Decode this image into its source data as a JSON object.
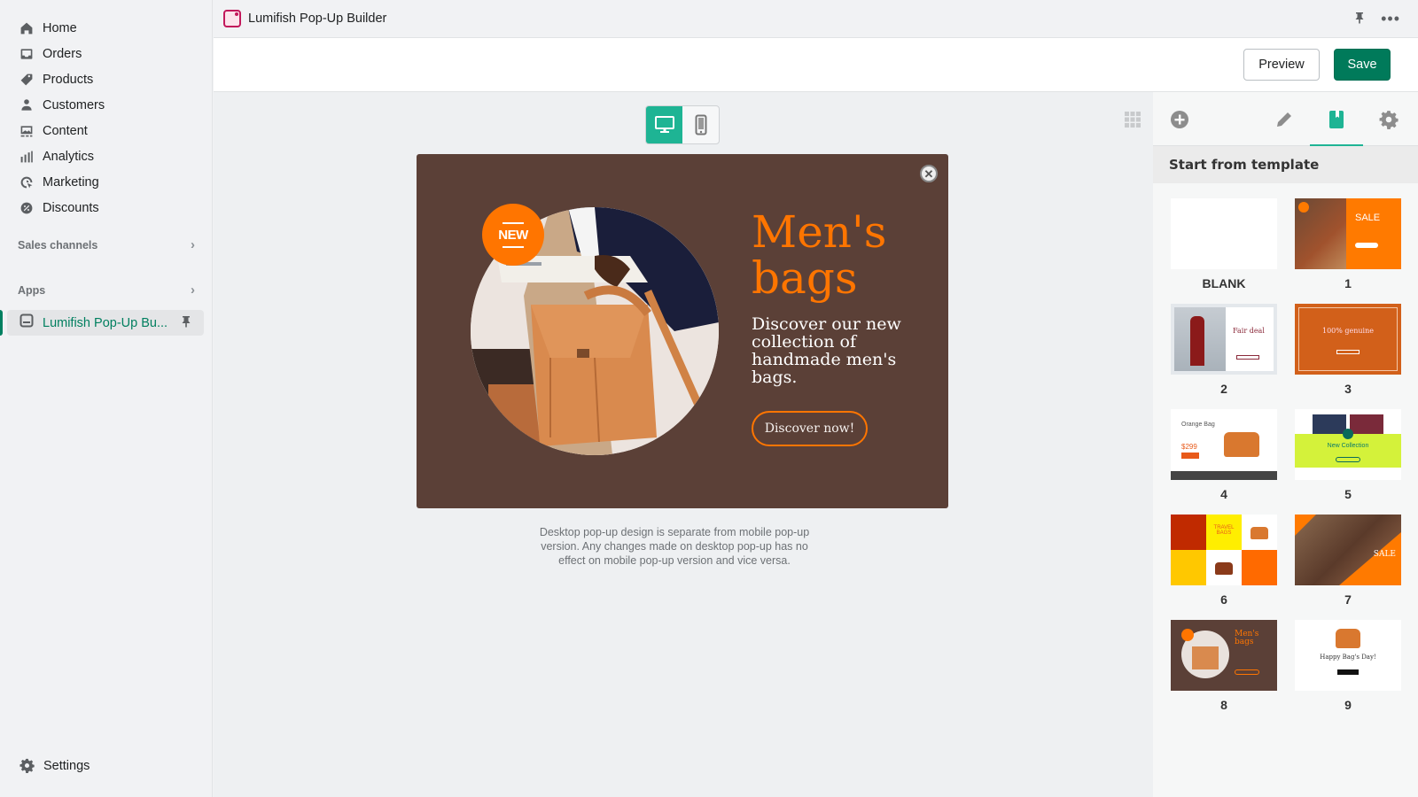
{
  "sidebar": {
    "nav": [
      {
        "label": "Home",
        "icon": "home-icon"
      },
      {
        "label": "Orders",
        "icon": "inbox-icon"
      },
      {
        "label": "Products",
        "icon": "tag-icon"
      },
      {
        "label": "Customers",
        "icon": "person-icon"
      },
      {
        "label": "Content",
        "icon": "image-icon"
      },
      {
        "label": "Analytics",
        "icon": "bar-chart-icon"
      },
      {
        "label": "Marketing",
        "icon": "target-icon"
      },
      {
        "label": "Discounts",
        "icon": "discount-icon"
      }
    ],
    "sales_channels_label": "Sales channels",
    "apps_label": "Apps",
    "active_app_label": "Lumifish Pop-Up Bu...",
    "settings_label": "Settings"
  },
  "titlebar": {
    "title": "Lumifish Pop-Up Builder"
  },
  "actions": {
    "preview_label": "Preview",
    "save_label": "Save"
  },
  "canvas": {
    "device_selected": "desktop",
    "popup": {
      "badge": "NEW",
      "title": "Men's bags",
      "text": "Discover our new collection of handmade men's bags.",
      "button_label": "Discover now!",
      "bg_color": "#5b4037",
      "accent_color": "#ff7500"
    },
    "note": "Desktop pop-up design is separate from mobile pop-up version. Any changes made on desktop pop-up has no effect on mobile pop-up version and vice versa."
  },
  "right_panel": {
    "active_tab": "templates",
    "heading": "Start from template",
    "templates": [
      {
        "label": "BLANK"
      },
      {
        "label": "1",
        "caption": "SALE"
      },
      {
        "label": "2",
        "caption": "Fair deal"
      },
      {
        "label": "3",
        "caption": "100% genuine"
      },
      {
        "label": "4",
        "caption": "Orange Bag"
      },
      {
        "label": "5",
        "caption": "New Collection"
      },
      {
        "label": "6",
        "caption": "TRAVEL BAGS"
      },
      {
        "label": "7",
        "caption": "SALE"
      },
      {
        "label": "8",
        "caption": "Men's bags"
      },
      {
        "label": "9",
        "caption": "Happy Bag's Day!"
      }
    ]
  }
}
